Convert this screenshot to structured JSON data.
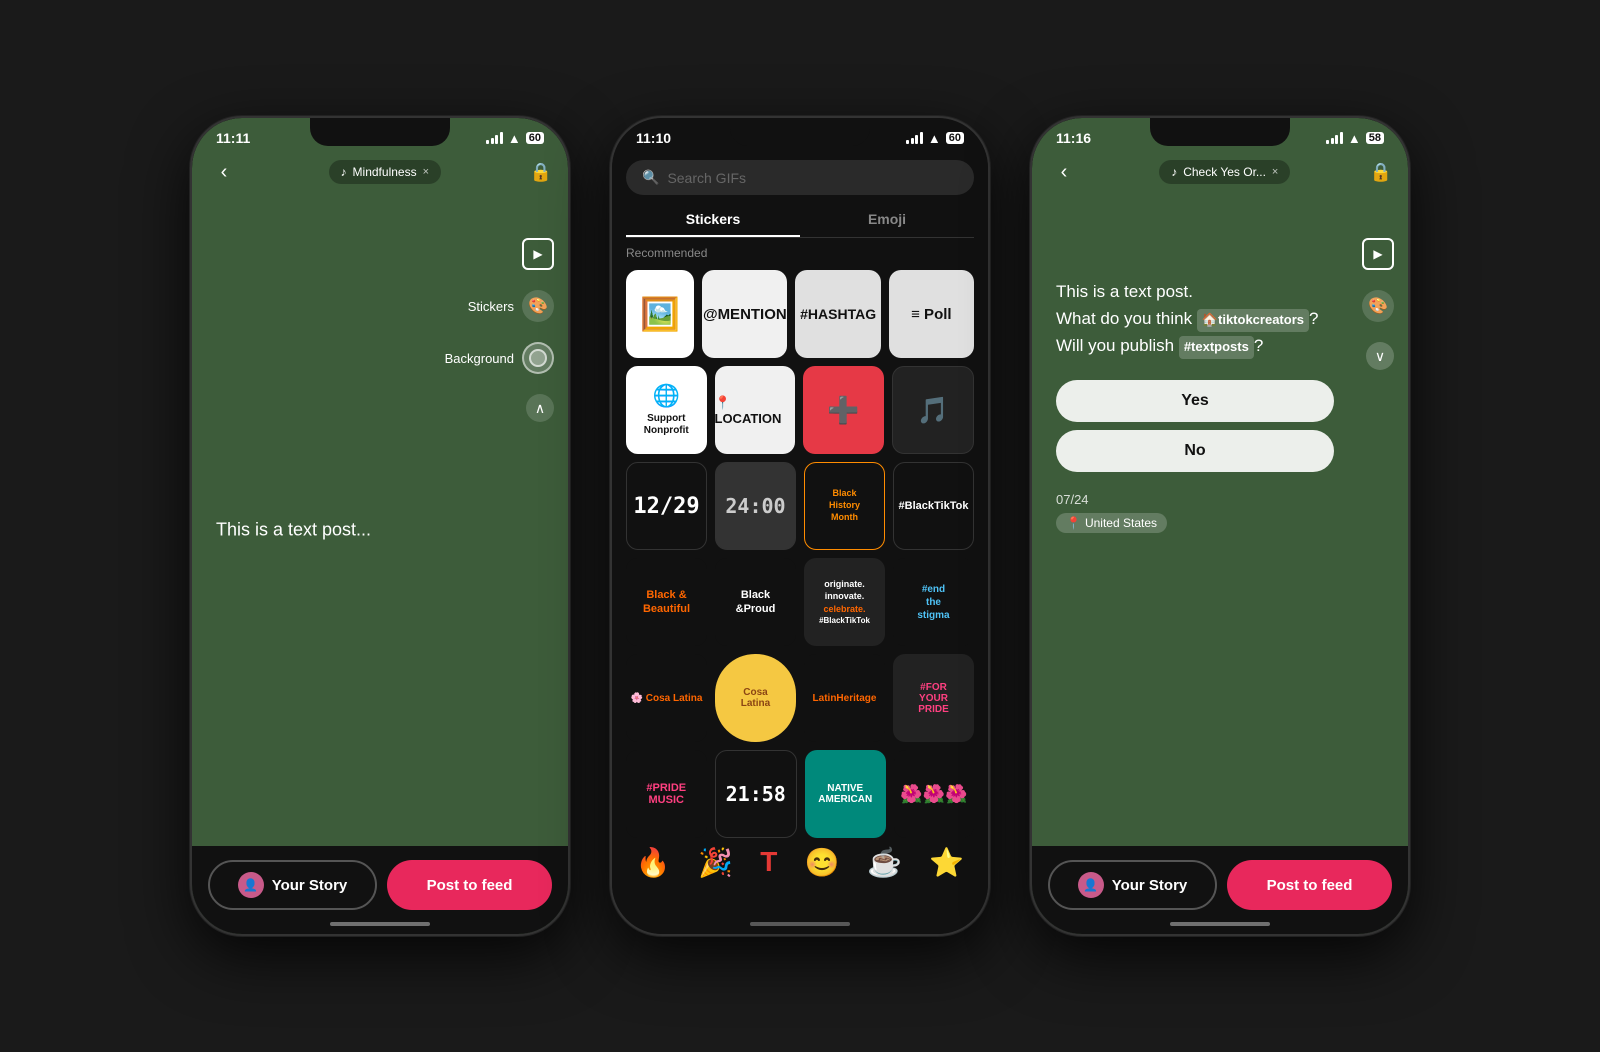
{
  "phone1": {
    "status_time": "11:11",
    "music_tag": "Mindfulness",
    "header_tools": {
      "stickers_label": "Stickers",
      "background_label": "Background"
    },
    "post_text": "This is a text post...",
    "btn_story": "Your Story",
    "btn_feed": "Post to feed",
    "background_color": "#3d5c3a"
  },
  "phone2": {
    "status_time": "11:10",
    "search_placeholder": "Search GIFs",
    "tab_stickers": "Stickers",
    "tab_emoji": "Emoji",
    "recommended_label": "Recommended",
    "background_color": "#111111",
    "sticker_rows": [
      [
        {
          "label": "Add photo",
          "type": "add-photo",
          "bg": "#fff"
        },
        {
          "label": "@MENTION",
          "type": "mention",
          "bg": "#f0f0f0"
        },
        {
          "label": "#HASHTAG",
          "type": "hashtag",
          "bg": "#e0e0e0"
        },
        {
          "label": "≡ Poll",
          "type": "poll",
          "bg": "#e0e0e0"
        }
      ],
      [
        {
          "label": "Support Nonprofit",
          "type": "support",
          "bg": "#fff"
        },
        {
          "label": "📍 LOCATION",
          "type": "location",
          "bg": "#f5f5f5"
        },
        {
          "label": "🏥",
          "type": "medical",
          "bg": "#ff4444"
        },
        {
          "label": "🎵",
          "type": "music",
          "bg": "#111"
        }
      ],
      [
        {
          "label": "12/29",
          "type": "date",
          "bg": "#111"
        },
        {
          "label": "24:00",
          "type": "time24",
          "bg": "#111"
        },
        {
          "label": "Black History Month",
          "type": "bhm",
          "bg": "#111"
        },
        {
          "label": "#BlackTikTok",
          "type": "blacktiktok",
          "bg": "#111"
        }
      ]
    ]
  },
  "phone3": {
    "status_time": "11:16",
    "music_tag": "Check Yes Or...",
    "post_lines": [
      "This is a text post.",
      "What do you think",
      "Will you publish"
    ],
    "hashtag1": "tiktokcreators",
    "hashtag2": "textposts",
    "poll_yes": "Yes",
    "poll_no": "No",
    "post_date": "07/24",
    "location": "United States",
    "btn_story": "Your Story",
    "btn_feed": "Post to feed",
    "background_color": "#3d5c3a"
  },
  "icons": {
    "back": "‹",
    "lock": "🔒",
    "music_note": "♪",
    "close_x": "×",
    "search": "🔍",
    "sticker_icon": "🎨",
    "background_icon": "⬤",
    "chevron_up": "∧",
    "chevron_down": "∨",
    "video_play": "▶",
    "pin": "📍",
    "fire": "🔥",
    "confetti": "🎉",
    "smile": "😊",
    "coffee": "☕",
    "star": "⭐"
  }
}
